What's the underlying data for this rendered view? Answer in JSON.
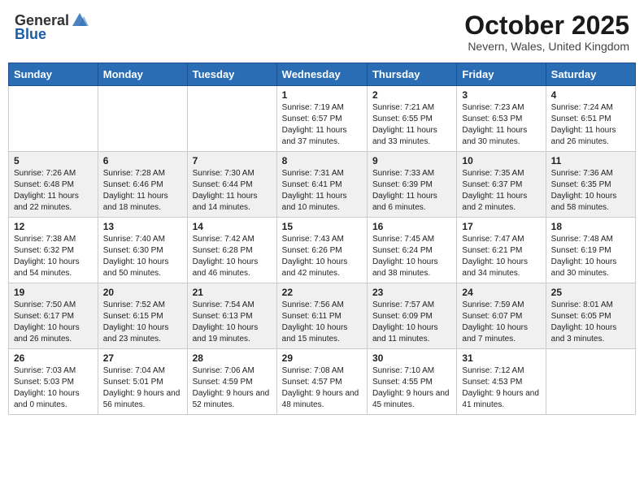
{
  "header": {
    "logo_general": "General",
    "logo_blue": "Blue",
    "month_title": "October 2025",
    "location": "Nevern, Wales, United Kingdom"
  },
  "columns": [
    "Sunday",
    "Monday",
    "Tuesday",
    "Wednesday",
    "Thursday",
    "Friday",
    "Saturday"
  ],
  "weeks": [
    {
      "days": [
        {
          "num": "",
          "info": ""
        },
        {
          "num": "",
          "info": ""
        },
        {
          "num": "",
          "info": ""
        },
        {
          "num": "1",
          "info": "Sunrise: 7:19 AM\nSunset: 6:57 PM\nDaylight: 11 hours and 37 minutes."
        },
        {
          "num": "2",
          "info": "Sunrise: 7:21 AM\nSunset: 6:55 PM\nDaylight: 11 hours and 33 minutes."
        },
        {
          "num": "3",
          "info": "Sunrise: 7:23 AM\nSunset: 6:53 PM\nDaylight: 11 hours and 30 minutes."
        },
        {
          "num": "4",
          "info": "Sunrise: 7:24 AM\nSunset: 6:51 PM\nDaylight: 11 hours and 26 minutes."
        }
      ]
    },
    {
      "days": [
        {
          "num": "5",
          "info": "Sunrise: 7:26 AM\nSunset: 6:48 PM\nDaylight: 11 hours and 22 minutes."
        },
        {
          "num": "6",
          "info": "Sunrise: 7:28 AM\nSunset: 6:46 PM\nDaylight: 11 hours and 18 minutes."
        },
        {
          "num": "7",
          "info": "Sunrise: 7:30 AM\nSunset: 6:44 PM\nDaylight: 11 hours and 14 minutes."
        },
        {
          "num": "8",
          "info": "Sunrise: 7:31 AM\nSunset: 6:41 PM\nDaylight: 11 hours and 10 minutes."
        },
        {
          "num": "9",
          "info": "Sunrise: 7:33 AM\nSunset: 6:39 PM\nDaylight: 11 hours and 6 minutes."
        },
        {
          "num": "10",
          "info": "Sunrise: 7:35 AM\nSunset: 6:37 PM\nDaylight: 11 hours and 2 minutes."
        },
        {
          "num": "11",
          "info": "Sunrise: 7:36 AM\nSunset: 6:35 PM\nDaylight: 10 hours and 58 minutes."
        }
      ]
    },
    {
      "days": [
        {
          "num": "12",
          "info": "Sunrise: 7:38 AM\nSunset: 6:32 PM\nDaylight: 10 hours and 54 minutes."
        },
        {
          "num": "13",
          "info": "Sunrise: 7:40 AM\nSunset: 6:30 PM\nDaylight: 10 hours and 50 minutes."
        },
        {
          "num": "14",
          "info": "Sunrise: 7:42 AM\nSunset: 6:28 PM\nDaylight: 10 hours and 46 minutes."
        },
        {
          "num": "15",
          "info": "Sunrise: 7:43 AM\nSunset: 6:26 PM\nDaylight: 10 hours and 42 minutes."
        },
        {
          "num": "16",
          "info": "Sunrise: 7:45 AM\nSunset: 6:24 PM\nDaylight: 10 hours and 38 minutes."
        },
        {
          "num": "17",
          "info": "Sunrise: 7:47 AM\nSunset: 6:21 PM\nDaylight: 10 hours and 34 minutes."
        },
        {
          "num": "18",
          "info": "Sunrise: 7:48 AM\nSunset: 6:19 PM\nDaylight: 10 hours and 30 minutes."
        }
      ]
    },
    {
      "days": [
        {
          "num": "19",
          "info": "Sunrise: 7:50 AM\nSunset: 6:17 PM\nDaylight: 10 hours and 26 minutes."
        },
        {
          "num": "20",
          "info": "Sunrise: 7:52 AM\nSunset: 6:15 PM\nDaylight: 10 hours and 23 minutes."
        },
        {
          "num": "21",
          "info": "Sunrise: 7:54 AM\nSunset: 6:13 PM\nDaylight: 10 hours and 19 minutes."
        },
        {
          "num": "22",
          "info": "Sunrise: 7:56 AM\nSunset: 6:11 PM\nDaylight: 10 hours and 15 minutes."
        },
        {
          "num": "23",
          "info": "Sunrise: 7:57 AM\nSunset: 6:09 PM\nDaylight: 10 hours and 11 minutes."
        },
        {
          "num": "24",
          "info": "Sunrise: 7:59 AM\nSunset: 6:07 PM\nDaylight: 10 hours and 7 minutes."
        },
        {
          "num": "25",
          "info": "Sunrise: 8:01 AM\nSunset: 6:05 PM\nDaylight: 10 hours and 3 minutes."
        }
      ]
    },
    {
      "days": [
        {
          "num": "26",
          "info": "Sunrise: 7:03 AM\nSunset: 5:03 PM\nDaylight: 10 hours and 0 minutes."
        },
        {
          "num": "27",
          "info": "Sunrise: 7:04 AM\nSunset: 5:01 PM\nDaylight: 9 hours and 56 minutes."
        },
        {
          "num": "28",
          "info": "Sunrise: 7:06 AM\nSunset: 4:59 PM\nDaylight: 9 hours and 52 minutes."
        },
        {
          "num": "29",
          "info": "Sunrise: 7:08 AM\nSunset: 4:57 PM\nDaylight: 9 hours and 48 minutes."
        },
        {
          "num": "30",
          "info": "Sunrise: 7:10 AM\nSunset: 4:55 PM\nDaylight: 9 hours and 45 minutes."
        },
        {
          "num": "31",
          "info": "Sunrise: 7:12 AM\nSunset: 4:53 PM\nDaylight: 9 hours and 41 minutes."
        },
        {
          "num": "",
          "info": ""
        }
      ]
    }
  ]
}
